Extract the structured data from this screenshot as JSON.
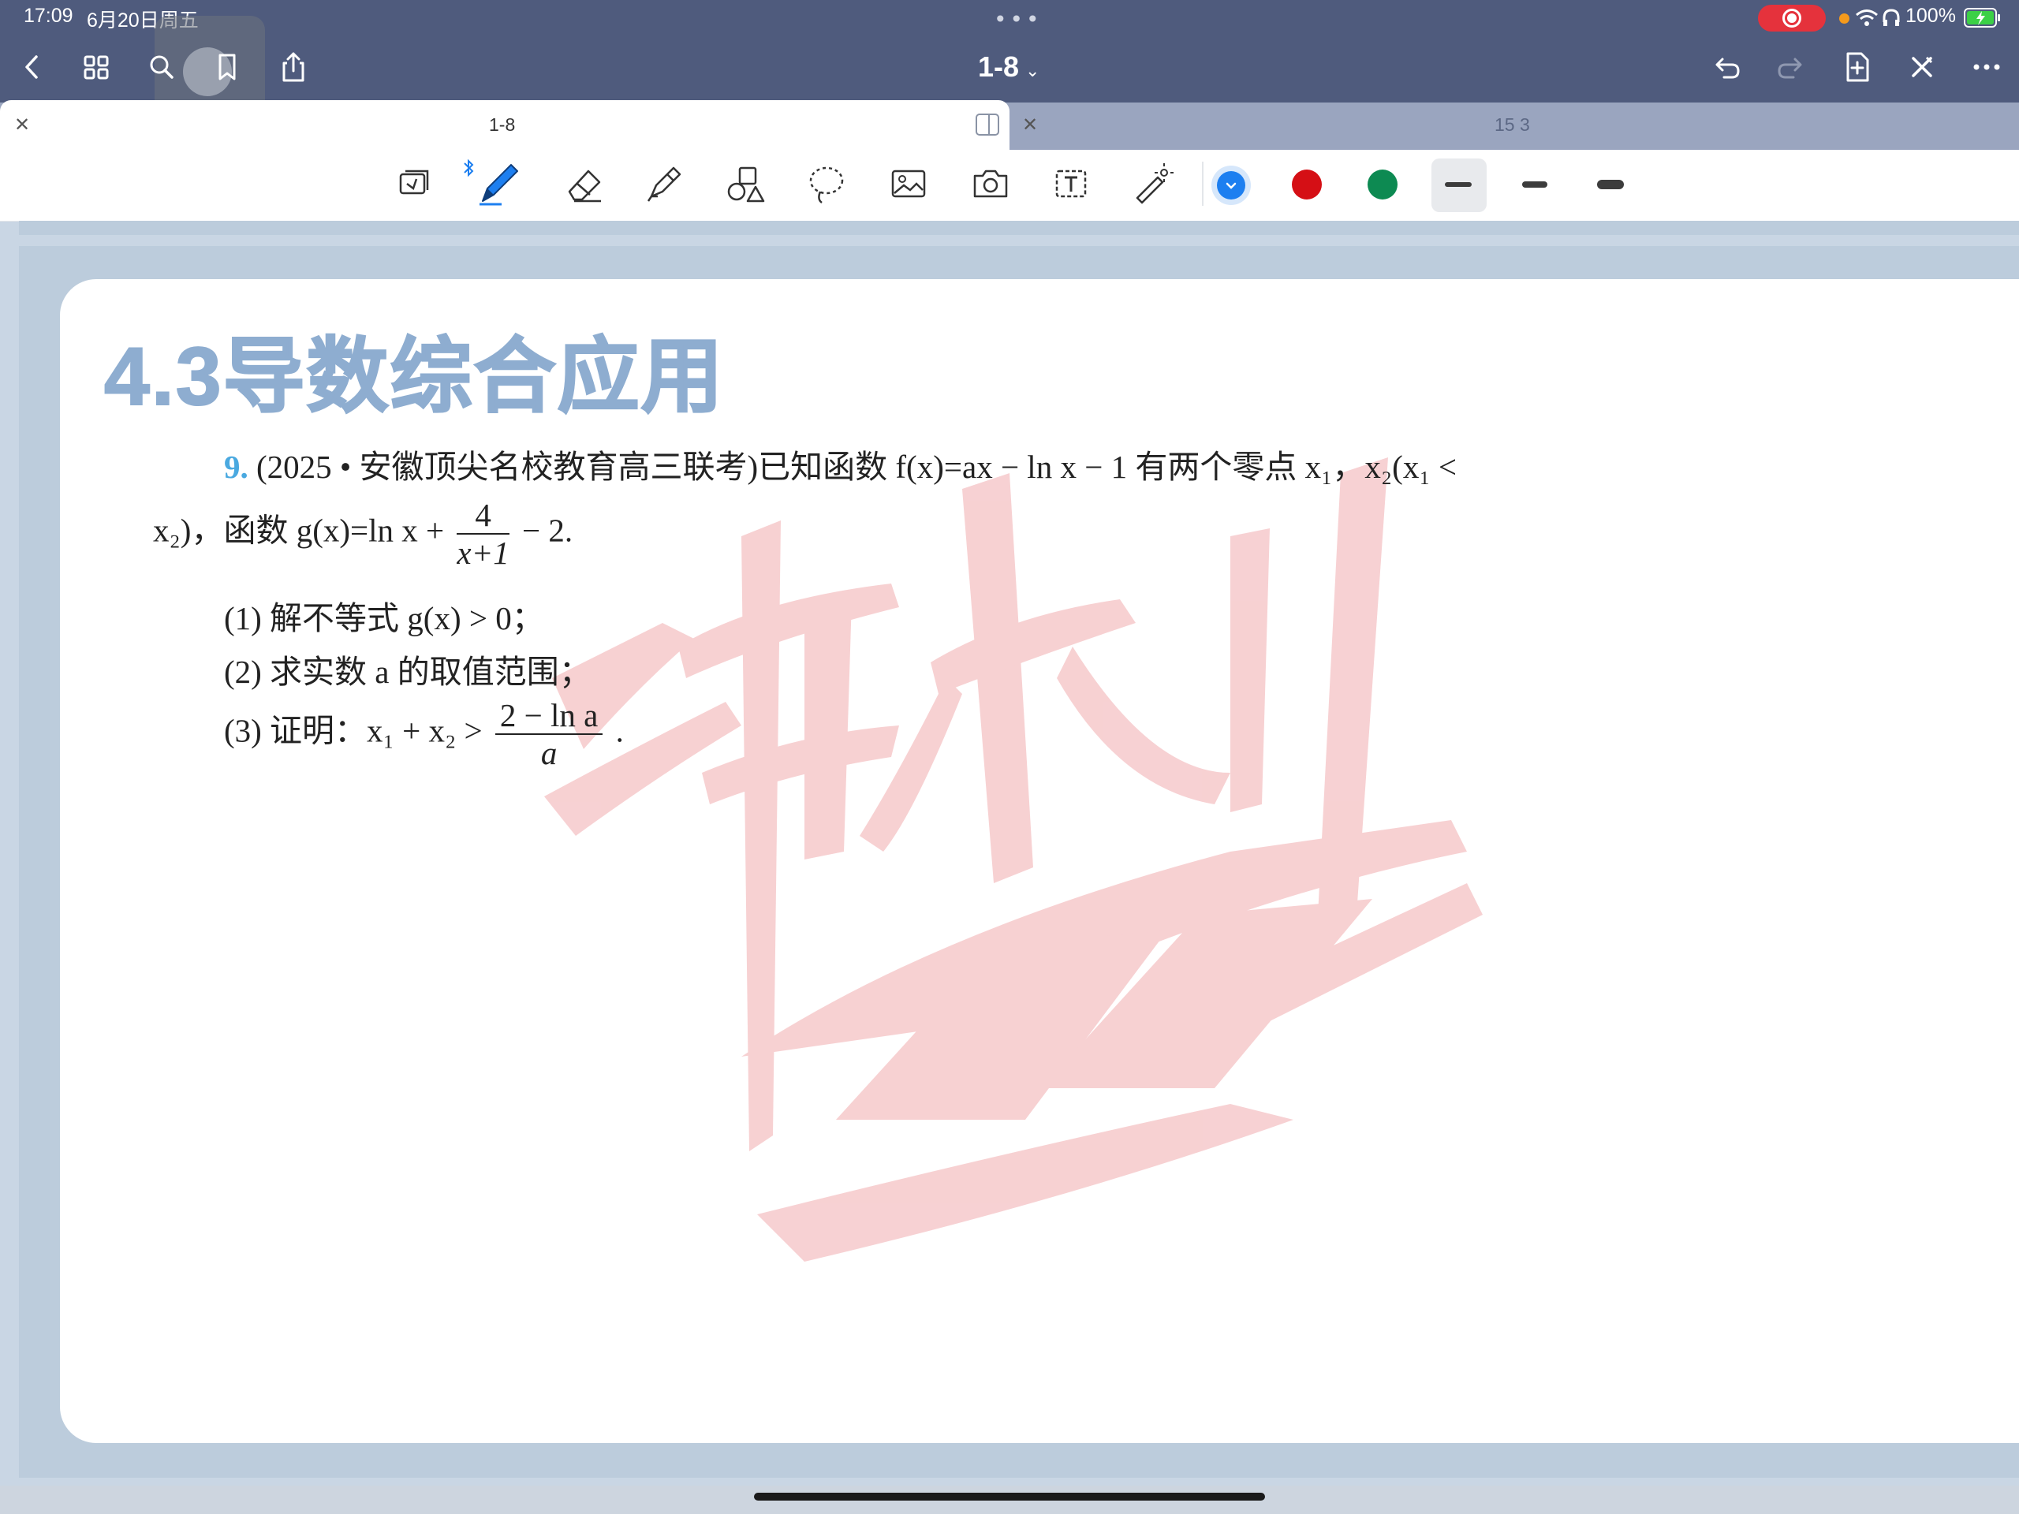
{
  "status_bar": {
    "time": "17:09",
    "date": "6月20日周五",
    "battery": "100%"
  },
  "header": {
    "title": "1-8",
    "dropdown_icon": "chevron-down-icon"
  },
  "tabs": [
    {
      "label": "1-8",
      "active": true
    },
    {
      "label": "15 3",
      "active": false
    }
  ],
  "toolbar": {
    "tools": [
      "read-mode-icon",
      "pen-icon",
      "eraser-icon",
      "highlighter-icon",
      "shapes-icon",
      "lasso-icon",
      "image-icon",
      "camera-icon",
      "text-box-icon",
      "laser-pointer-icon"
    ],
    "colors": [
      "#1d7ff0",
      "#d50f15",
      "#0d8a52"
    ],
    "selected_color": "#1d7ff0"
  },
  "document": {
    "heading": "4.3导数综合应用",
    "problem_number": "9.",
    "line1": "(2025 • 安徽顶尖名校教育高三联考)已知函数 f(x)=ax − ln x − 1 有两个零点 x₁，x₂(x₁ <",
    "line2_start": "x₂)，函数 g(x)=ln x +",
    "line2_frac_num": "4",
    "line2_frac_den": "x+1",
    "line2_end": "− 2.",
    "part1": "(1) 解不等式 g(x) > 0；",
    "part2": "(2) 求实数 a 的取值范围；",
    "part3_start": "(3) 证明：x₁ + x₂ >",
    "part3_frac_num": "2 − ln a",
    "part3_frac_den": "a",
    "part3_end": "."
  }
}
